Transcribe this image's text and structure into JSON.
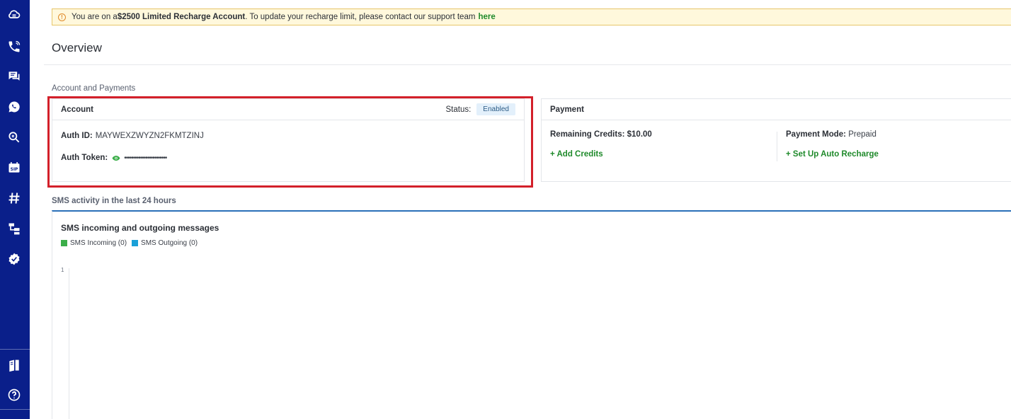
{
  "sidebar": {
    "icons": [
      "cloud-icon",
      "phone-icon",
      "messages-icon",
      "whatsapp-icon",
      "search-numbers-icon",
      "sip-icon",
      "hash-icon",
      "flow-icon",
      "verify-icon",
      "docs-icon",
      "help-icon"
    ]
  },
  "banner": {
    "prefix": "You are on a ",
    "bold": "$2500 Limited Recharge Account",
    "suffix": ". To update your recharge limit, please contact our support team",
    "link": "here"
  },
  "page": {
    "title": "Overview"
  },
  "account_payments": {
    "section_label": "Account and Payments",
    "account": {
      "title": "Account",
      "status_label": "Status:",
      "status_value": "Enabled",
      "auth_id_label": "Auth ID:",
      "auth_id_value": "MAYWEXZWYZN2FKMTZINJ",
      "auth_token_label": "Auth Token:",
      "auth_token_value": "••••••••••••••••••••••••"
    },
    "payment": {
      "title": "Payment",
      "remaining_label": "Remaining Credits:",
      "remaining_value": "$10.00",
      "mode_label": "Payment Mode:",
      "mode_value": "Prepaid",
      "add_credits": "+ Add Credits",
      "auto_recharge": "+ Set Up Auto Recharge"
    }
  },
  "sms": {
    "section_label": "SMS activity in the last 24 hours",
    "chart_title": "SMS incoming and outgoing messages",
    "legend_incoming": "SMS Incoming (0)",
    "legend_outgoing": "SMS Outgoing (0)",
    "y_tick": "1"
  },
  "colors": {
    "sidebar": "#0a1f8a",
    "incoming": "#3bae49",
    "outgoing": "#1aa0d8",
    "link": "#1f8a2b",
    "highlight": "#d3202a"
  },
  "chart_data": {
    "type": "line",
    "title": "SMS incoming and outgoing messages",
    "series": [
      {
        "name": "SMS Incoming (0)",
        "values": []
      },
      {
        "name": "SMS Outgoing (0)",
        "values": []
      }
    ],
    "y_ticks": [
      "1"
    ]
  }
}
